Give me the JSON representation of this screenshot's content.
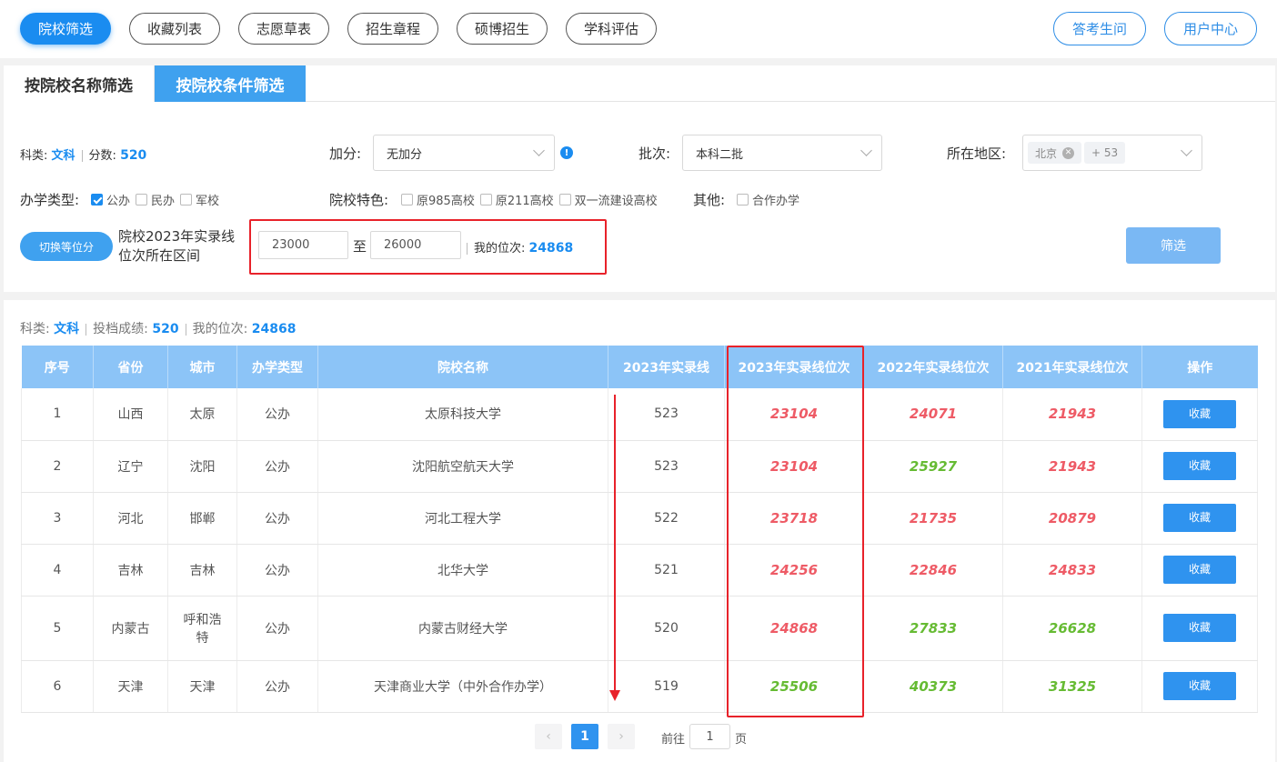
{
  "nav": {
    "tabs": [
      "院校筛选",
      "收藏列表",
      "志愿草表",
      "招生章程",
      "硕博招生",
      "学科评估"
    ],
    "right": [
      "答考生问",
      "用户中心"
    ]
  },
  "filter_tabs": [
    "按院校名称筛选",
    "按院校条件筛选"
  ],
  "row1": {
    "subject_label": "科类:",
    "subject": "文科",
    "score_label": "分数:",
    "score": "520",
    "bonus_label": "加分:",
    "bonus_value": "无加分",
    "batch_label": "批次:",
    "batch_value": "本科二批",
    "region_label": "所在地区:",
    "region_tag": "北京",
    "region_more": "+ 53"
  },
  "row2": {
    "type_label": "办学类型:",
    "types": [
      "公办",
      "民办",
      "军校"
    ],
    "feature_label": "院校特色:",
    "features": [
      "原985高校",
      "原211高校",
      "双一流建设高校"
    ],
    "other_label": "其他:",
    "others": [
      "合作办学"
    ]
  },
  "row3": {
    "switch_btn": "切换等位分",
    "range_label_1": "院校2023年实录线",
    "range_label_2": "位次所在区间",
    "from": "23000",
    "to_label": "至",
    "to": "26000",
    "my_rank_label": "我的位次:",
    "my_rank": "24868",
    "filter_btn": "筛选"
  },
  "summary": {
    "subject_label": "科类:",
    "subject": "文科",
    "score_label": "投档成绩:",
    "score": "520",
    "rank_label": "我的位次:",
    "rank": "24868"
  },
  "table": {
    "headers": [
      "序号",
      "省份",
      "城市",
      "办学类型",
      "院校名称",
      "2023年实录线",
      "2023年实录线位次",
      "2022年实录线位次",
      "2021年实录线位次",
      "操作"
    ],
    "fav_label": "收藏",
    "rows": [
      {
        "no": "1",
        "province": "山西",
        "city": "太原",
        "type": "公办",
        "name": "太原科技大学",
        "line": "523",
        "r2023": "23104",
        "r2022": "24071",
        "r2021": "21943",
        "c2023": "red",
        "c2022": "red",
        "c2021": "red"
      },
      {
        "no": "2",
        "province": "辽宁",
        "city": "沈阳",
        "type": "公办",
        "name": "沈阳航空航天大学",
        "line": "523",
        "r2023": "23104",
        "r2022": "25927",
        "r2021": "21943",
        "c2023": "red",
        "c2022": "green",
        "c2021": "red"
      },
      {
        "no": "3",
        "province": "河北",
        "city": "邯郸",
        "type": "公办",
        "name": "河北工程大学",
        "line": "522",
        "r2023": "23718",
        "r2022": "21735",
        "r2021": "20879",
        "c2023": "red",
        "c2022": "red",
        "c2021": "red"
      },
      {
        "no": "4",
        "province": "吉林",
        "city": "吉林",
        "type": "公办",
        "name": "北华大学",
        "line": "521",
        "r2023": "24256",
        "r2022": "22846",
        "r2021": "24833",
        "c2023": "red",
        "c2022": "red",
        "c2021": "red"
      },
      {
        "no": "5",
        "province": "内蒙古",
        "city": "呼和浩特",
        "type": "公办",
        "name": "内蒙古财经大学",
        "line": "520",
        "r2023": "24868",
        "r2022": "27833",
        "r2021": "26628",
        "c2023": "red",
        "c2022": "green",
        "c2021": "green"
      },
      {
        "no": "6",
        "province": "天津",
        "city": "天津",
        "type": "公办",
        "name": "天津商业大学（中外合作办学）",
        "line": "519",
        "r2023": "25506",
        "r2022": "40373",
        "r2021": "31325",
        "c2023": "green",
        "c2022": "green",
        "c2021": "green"
      }
    ]
  },
  "pager": {
    "prev": "‹",
    "page": "1",
    "next": "›",
    "goto_label": "前往",
    "goto_value": "1",
    "page_label": "页"
  },
  "colors": {
    "primary": "#1a8cf0",
    "header": "#8cc4f7",
    "red_rank": "#ee5b66",
    "green_rank": "#66bb33",
    "highlight": "#e8222a"
  }
}
